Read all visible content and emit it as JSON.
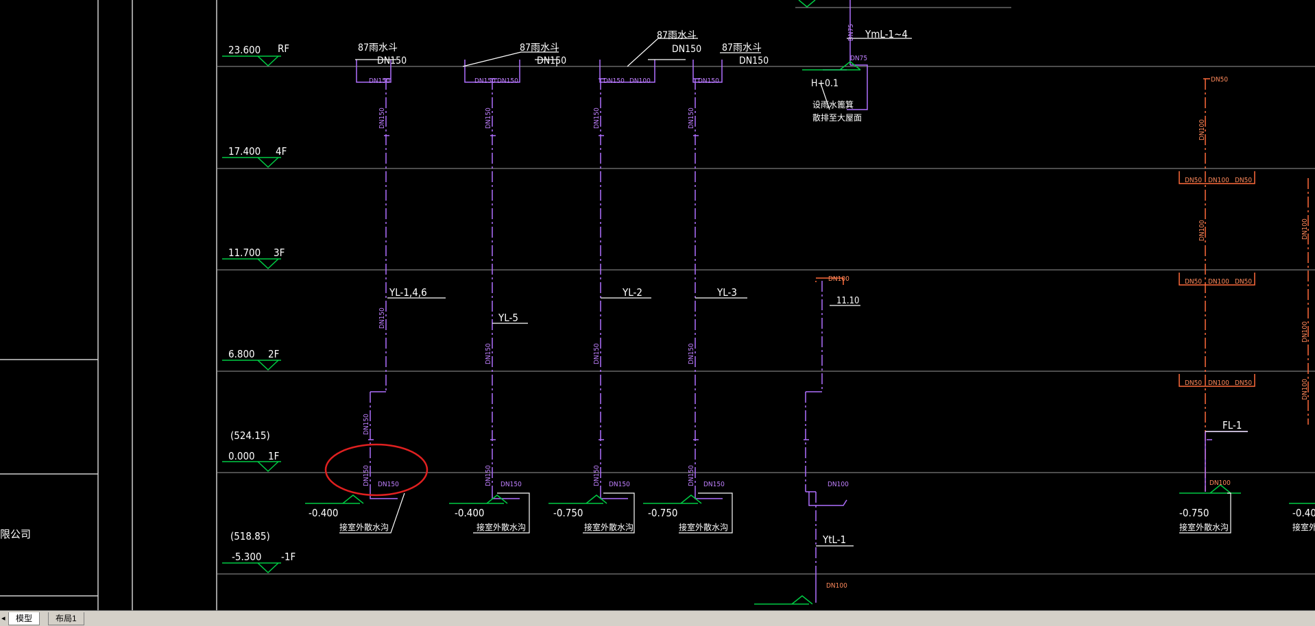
{
  "tabs": [
    {
      "label": "模型",
      "active": true
    },
    {
      "label": "布局1",
      "active": false
    }
  ],
  "floors": [
    {
      "elev": "23.600",
      "name": "RF"
    },
    {
      "elev": "17.400",
      "name": "4F"
    },
    {
      "elev": "11.700",
      "name": "3F"
    },
    {
      "elev": "6.800",
      "name": "2F"
    },
    {
      "elev": "0.000",
      "name": "1F",
      "note": "(524.15)"
    },
    {
      "elev": "-5.300",
      "name": "-1F",
      "note": "(518.85)"
    }
  ],
  "company_fragment": "限公司",
  "roof_labels": {
    "drain_87": "87雨水斗",
    "dn150": "DN150",
    "dn75": "DN75",
    "yml": "YmL-1~4",
    "h01": "H+0.1",
    "vent_note_1": "设雨水篦箕",
    "vent_note_2": "散排至大屋面",
    "dn100": "DN100",
    "dn50": "DN50"
  },
  "pipe_labels": {
    "yl146": "YL-1,4,6",
    "yl5": "YL-5",
    "yl2": "YL-2",
    "yl3": "YL-3",
    "ytl1": "YtL-1",
    "fl1": "FL-1",
    "h1110": "11.10"
  },
  "outlets": {
    "e040": "-0.400",
    "e075": "-0.750",
    "ditch": "接室外散水沟"
  },
  "colors": {
    "background": "#000000",
    "grid": "#9a9a9a",
    "pipe_rain": "#b070ff",
    "pipe_waste": "#ff6a3a",
    "ground": "#00cc44",
    "highlight": "#e02020"
  }
}
